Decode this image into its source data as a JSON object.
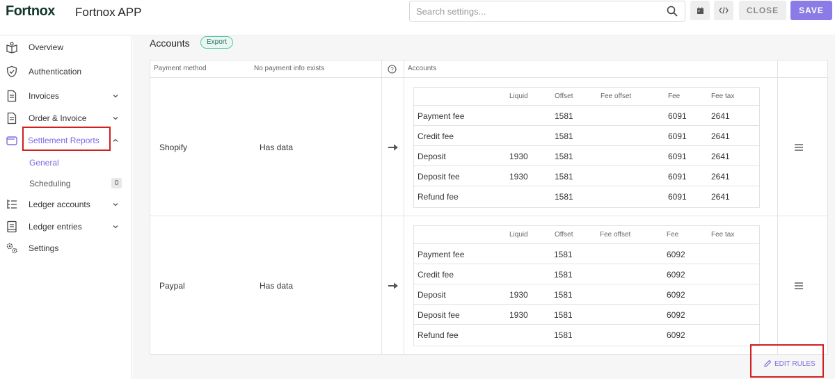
{
  "header": {
    "logo": "Fortnox",
    "app_title": "Fortnox APP",
    "search_placeholder": "Search settings...",
    "close_label": "CLOSE",
    "save_label": "SAVE"
  },
  "sidebar": {
    "items": [
      {
        "label": "Overview",
        "icon": "book-icon"
      },
      {
        "label": "Authentication",
        "icon": "shield-check-icon"
      },
      {
        "label": "Invoices",
        "icon": "document-icon",
        "expandable": true
      },
      {
        "label": "Order & Invoice",
        "icon": "document-icon",
        "expandable": true
      },
      {
        "label": "Settlement Reports",
        "icon": "wallet-icon",
        "expanded": true,
        "active": true
      },
      {
        "label": "Ledger accounts",
        "icon": "list-tree-icon",
        "expandable": true
      },
      {
        "label": "Ledger entries",
        "icon": "ledger-icon",
        "expandable": true
      },
      {
        "label": "Settings",
        "icon": "gears-icon"
      }
    ],
    "sub_items": [
      {
        "label": "General",
        "active": true
      },
      {
        "label": "Scheduling",
        "badge": "0"
      }
    ]
  },
  "main": {
    "section_title": "Accounts",
    "export_label": "Export",
    "table": {
      "headers": {
        "payment_method": "Payment method",
        "no_info": "No payment info exists",
        "accounts": "Accounts"
      },
      "inner_headers": [
        "Liquid",
        "Offset",
        "Fee offset",
        "Fee",
        "Fee tax"
      ],
      "rows": [
        {
          "method": "Shopify",
          "status": "Has data",
          "accounts": [
            [
              "Payment fee",
              "",
              "1581",
              "",
              "6091",
              "2641"
            ],
            [
              "Credit fee",
              "",
              "1581",
              "",
              "6091",
              "2641"
            ],
            [
              "Deposit",
              "1930",
              "1581",
              "",
              "6091",
              "2641"
            ],
            [
              "Deposit fee",
              "1930",
              "1581",
              "",
              "6091",
              "2641"
            ],
            [
              "Refund fee",
              "",
              "1581",
              "",
              "6091",
              "2641"
            ]
          ]
        },
        {
          "method": "Paypal",
          "status": "Has data",
          "accounts": [
            [
              "Payment fee",
              "",
              "1581",
              "",
              "6092",
              ""
            ],
            [
              "Credit fee",
              "",
              "1581",
              "",
              "6092",
              ""
            ],
            [
              "Deposit",
              "1930",
              "1581",
              "",
              "6092",
              ""
            ],
            [
              "Deposit fee",
              "1930",
              "1581",
              "",
              "6092",
              ""
            ],
            [
              "Refund fee",
              "",
              "1581",
              "",
              "6092",
              ""
            ]
          ]
        }
      ]
    },
    "edit_rules_label": "EDIT RULES"
  },
  "colors": {
    "accent": "#7c6cdf",
    "save": "#8b7be6",
    "highlight": "#d31e1e",
    "export": "#5cc3ab"
  }
}
